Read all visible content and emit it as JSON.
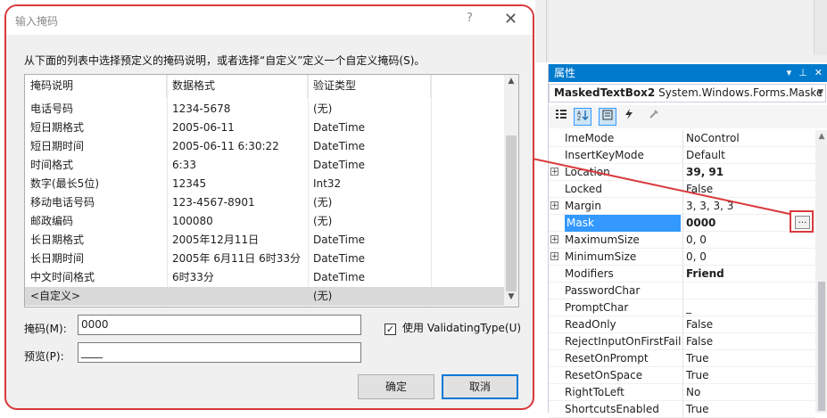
{
  "dialog": {
    "title": "输入掩码",
    "help_glyph": "?",
    "close_glyph": "✕",
    "description": "从下面的列表中选择预定义的掩码说明，或者选择“自定义”定义一个自定义掩码(S)。",
    "columns": [
      "掩码说明",
      "数据格式",
      "验证类型"
    ],
    "rows": [
      {
        "desc": "电话号码",
        "format": "1234-5678",
        "type": "(无)"
      },
      {
        "desc": "短日期格式",
        "format": "2005-06-11",
        "type": "DateTime"
      },
      {
        "desc": "短日期时间",
        "format": "2005-06-11  6:30:22",
        "type": "DateTime"
      },
      {
        "desc": "时间格式",
        "format": " 6:33",
        "type": "DateTime"
      },
      {
        "desc": "数字(最长5位)",
        "format": "12345",
        "type": "Int32"
      },
      {
        "desc": "移动电话号码",
        "format": "123-4567-8901",
        "type": "(无)"
      },
      {
        "desc": "邮政编码",
        "format": "100080",
        "type": "(无)"
      },
      {
        "desc": "长日期格式",
        "format": "2005年12月11日",
        "type": "DateTime"
      },
      {
        "desc": "长日期时间",
        "format": "2005年 6月11日  6时33分",
        "type": "DateTime"
      },
      {
        "desc": "中文时间格式",
        "format": " 6时33分",
        "type": "DateTime"
      },
      {
        "desc": "<自定义>",
        "format": "",
        "type": "(无)"
      }
    ],
    "mask_label": "掩码(M):",
    "mask_value": "0000",
    "use_validating_label": "使用 ValidatingType(U)",
    "use_validating_checked": true,
    "preview_label": "预览(P):",
    "preview_value": "____",
    "ok_label": "确定",
    "cancel_label": "取消"
  },
  "properties": {
    "title": "属性",
    "title_buttons": [
      "▾",
      "⊥",
      "✕"
    ],
    "object_name": "MaskedTextBox2",
    "object_type": "System.Windows.Forms.Maske",
    "rows": [
      {
        "name": "ImeMode",
        "value": "NoControl",
        "expandable": false,
        "bold": false,
        "selected": false
      },
      {
        "name": "InsertKeyMode",
        "value": "Default",
        "expandable": false,
        "bold": false,
        "selected": false
      },
      {
        "name": "Location",
        "value": "39, 91",
        "expandable": true,
        "bold": true,
        "selected": false
      },
      {
        "name": "Locked",
        "value": "False",
        "expandable": false,
        "bold": false,
        "selected": false
      },
      {
        "name": "Margin",
        "value": "3, 3, 3, 3",
        "expandable": true,
        "bold": false,
        "selected": false
      },
      {
        "name": "Mask",
        "value": "0000",
        "expandable": false,
        "bold": true,
        "selected": true
      },
      {
        "name": "MaximumSize",
        "value": "0, 0",
        "expandable": true,
        "bold": false,
        "selected": false
      },
      {
        "name": "MinimumSize",
        "value": "0, 0",
        "expandable": true,
        "bold": false,
        "selected": false
      },
      {
        "name": "Modifiers",
        "value": "Friend",
        "expandable": false,
        "bold": true,
        "selected": false
      },
      {
        "name": "PasswordChar",
        "value": "",
        "expandable": false,
        "bold": false,
        "selected": false
      },
      {
        "name": "PromptChar",
        "value": "_",
        "expandable": false,
        "bold": false,
        "selected": false
      },
      {
        "name": "ReadOnly",
        "value": "False",
        "expandable": false,
        "bold": false,
        "selected": false
      },
      {
        "name": "RejectInputOnFirstFailu",
        "value": "False",
        "expandable": false,
        "bold": false,
        "selected": false
      },
      {
        "name": "ResetOnPrompt",
        "value": "True",
        "expandable": false,
        "bold": false,
        "selected": false
      },
      {
        "name": "ResetOnSpace",
        "value": "True",
        "expandable": false,
        "bold": false,
        "selected": false
      },
      {
        "name": "RightToLeft",
        "value": "No",
        "expandable": false,
        "bold": false,
        "selected": false
      },
      {
        "name": "ShortcutsEnabled",
        "value": "True",
        "expandable": false,
        "bold": false,
        "selected": false
      }
    ],
    "ellipsis_label": "..."
  },
  "colors": {
    "highlight_red": "#d9393c",
    "accent_blue": "#007acc",
    "selection_blue": "#3399ff"
  }
}
